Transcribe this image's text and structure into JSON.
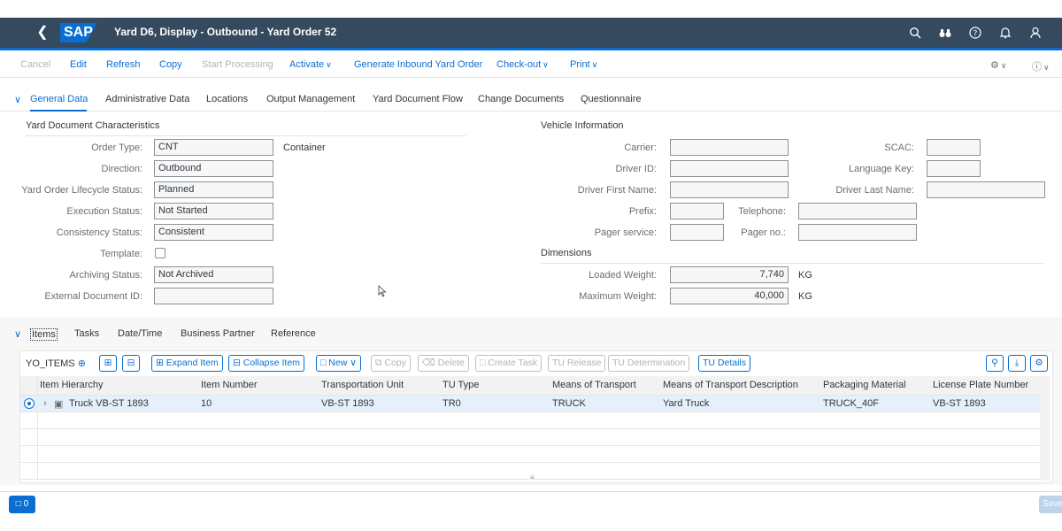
{
  "shell": {
    "title": "Yard D6, Display - Outbound - Yard Order 52",
    "logo": "SAP",
    "icons": [
      "back-icon",
      "search-icon",
      "binoculars-icon",
      "help-icon",
      "bell-icon",
      "user-icon"
    ]
  },
  "toolbar": {
    "cancel": "Cancel",
    "edit": "Edit",
    "refresh": "Refresh",
    "copy": "Copy",
    "start_processing": "Start Processing",
    "activate": "Activate",
    "generate_inbound": "Generate Inbound Yard Order",
    "check_out": "Check-out",
    "print": "Print"
  },
  "tabs": [
    "General Data",
    "Administrative Data",
    "Locations",
    "Output Management",
    "Yard Document Flow",
    "Change Documents",
    "Questionnaire"
  ],
  "characteristics": {
    "title": "Yard Document Characteristics",
    "order_type_label": "Order Type:",
    "order_type": "CNT",
    "order_type_desc": "Container",
    "direction_label": "Direction:",
    "direction": "Outbound",
    "lifecycle_label": "Yard Order Lifecycle Status:",
    "lifecycle": "Planned",
    "execution_label": "Execution Status:",
    "execution": "Not Started",
    "consistency_label": "Consistency Status:",
    "consistency": "Consistent",
    "template_label": "Template:",
    "archiving_label": "Archiving Status:",
    "archiving": "Not Archived",
    "external_label": "External Document ID:",
    "external": ""
  },
  "vehicle": {
    "title": "Vehicle Information",
    "carrier_label": "Carrier:",
    "driver_id_label": "Driver ID:",
    "first_name_label": "Driver First Name:",
    "prefix_label": "Prefix:",
    "pager_service_label": "Pager service:",
    "scac_label": "SCAC:",
    "language_label": "Language Key:",
    "last_name_label": "Driver Last Name:",
    "telephone_label": "Telephone:",
    "pager_no_label": "Pager no.:"
  },
  "dimensions": {
    "title": "Dimensions",
    "loaded_label": "Loaded Weight:",
    "loaded": "7,740",
    "loaded_unit": "KG",
    "max_label": "Maximum Weight:",
    "max": "40,000",
    "max_unit": "KG"
  },
  "item_tabs": [
    "Items",
    "Tasks",
    "Date/Time",
    "Business Partner",
    "Reference"
  ],
  "items_toolbar": {
    "variant": "YO_ITEMS",
    "expand": "Expand Item",
    "collapse": "Collapse Item",
    "new": "New",
    "copy": "Copy",
    "delete": "Delete",
    "create_task": "Create Task",
    "tu_release": "TU Release",
    "tu_determination": "TU Determination",
    "tu_details": "TU Details"
  },
  "table": {
    "columns": [
      "Item Hierarchy",
      "Item Number",
      "Transportation Unit",
      "TU Type",
      "Means of Transport",
      "Means of Transport Description",
      "Packaging Material",
      "License Plate Number"
    ],
    "rows": [
      [
        "Truck VB-ST 1893",
        "10",
        "VB-ST 1893",
        "TR0",
        "TRUCK",
        "Yard Truck",
        "TRUCK_40F",
        "VB-ST 1893"
      ]
    ]
  },
  "footer": {
    "messages": "0",
    "save": "Save"
  },
  "colors": {
    "shell": "#354a5f",
    "accent": "#0a6ed1"
  }
}
